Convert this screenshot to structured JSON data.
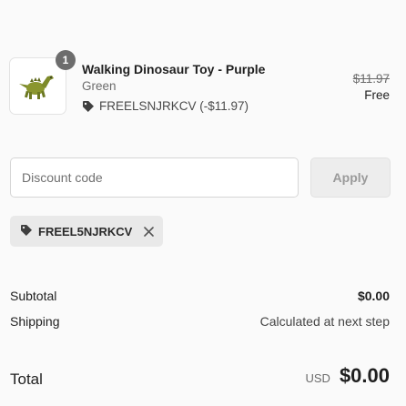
{
  "cart": {
    "item": {
      "quantity": "1",
      "title": "Walking Dinosaur Toy - Purple",
      "variant": "Green",
      "discount_line": "FREELSNJRKCV (-$11.97)",
      "original_price": "$11.97",
      "final_price": "Free",
      "thumbnail_icon": "dinosaur-toy-icon"
    }
  },
  "discount": {
    "placeholder": "Discount code",
    "value": "",
    "apply_label": "Apply",
    "applied_code": "FREEL5NJRKCV",
    "tag_icon": "tag-icon",
    "remove_icon": "close-icon"
  },
  "summary": {
    "subtotal_label": "Subtotal",
    "subtotal_value": "$0.00",
    "shipping_label": "Shipping",
    "shipping_value": "Calculated at next step",
    "total_label": "Total",
    "currency": "USD",
    "total_value": "$0.00"
  },
  "colors": {
    "background": "#fafafa",
    "badge": "#6d6d6d",
    "chip": "#e9e9e9",
    "apply_disabled": "#ededed",
    "dino_green": "#7d8a2a"
  }
}
